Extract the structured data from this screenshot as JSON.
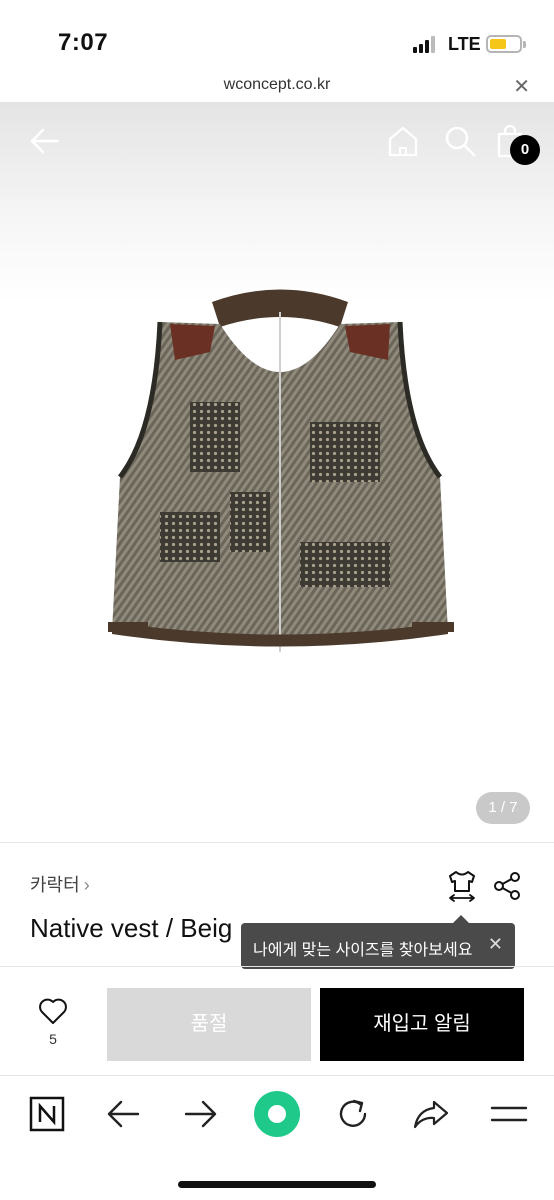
{
  "status_bar": {
    "time": "7:07",
    "network": "LTE"
  },
  "url_bar": {
    "url": "wconcept.co.kr",
    "close_symbol": "✕"
  },
  "header": {
    "cart_count": "0"
  },
  "gallery": {
    "page_indicator": "1 / 7"
  },
  "product": {
    "brand": "카락터",
    "brand_chevron": "›",
    "title": "Native vest / Beig"
  },
  "tooltip": {
    "text": "나에게 맞는 사이즈를 찾아보세요",
    "close_symbol": "✕"
  },
  "purchase": {
    "like_count": "5",
    "soldout_label": "품절",
    "restock_label": "재입고 알림"
  },
  "colors": {
    "accent_green": "#1ec98a",
    "battery_yellow": "#f5c518",
    "soldout_gray": "#d9d9d9"
  },
  "icons": [
    "back-arrow-icon",
    "home-icon",
    "search-icon",
    "cart-icon",
    "size-guide-icon",
    "share-icon",
    "heart-icon",
    "naver-n-icon",
    "browser-back-icon",
    "browser-forward-icon",
    "reload-icon",
    "share-arrow-icon",
    "menu-icon"
  ]
}
